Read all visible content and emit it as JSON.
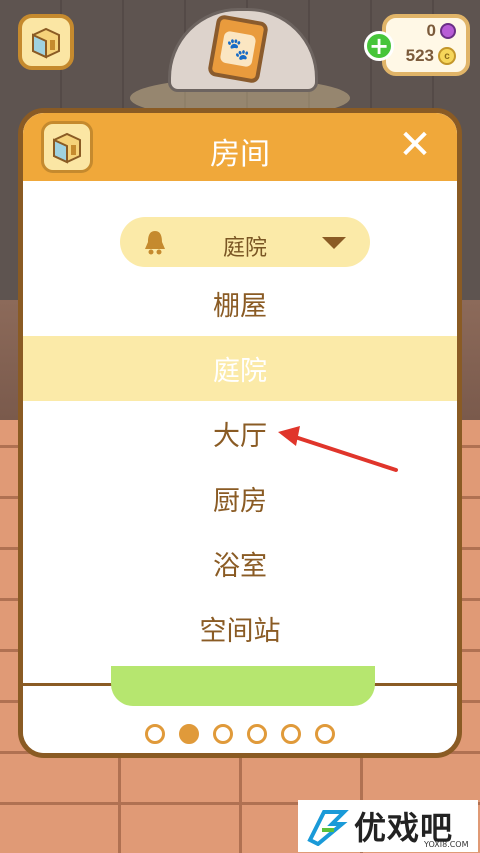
{
  "hud": {
    "room_icon": "room-icon",
    "card_icon": "paw-card-icon",
    "gems": "0",
    "coins": "523",
    "coin_symbol": "c",
    "plus": "+"
  },
  "modal": {
    "title": "房间",
    "close": "✕",
    "selected_room": "庭院",
    "rooms": [
      "棚屋",
      "庭院",
      "大厅",
      "厨房",
      "浴室",
      "空间站"
    ],
    "selected_index": 1,
    "page_count": 6,
    "active_page": 1
  },
  "colors": {
    "header": "#f0a83a",
    "selected_row": "#fbeaa8",
    "text_brown": "#8a5b24",
    "arrow_red": "#e0352b",
    "green_button": "#b6e66f"
  },
  "watermark": {
    "brand": "优戏吧",
    "domain": "YOXI8.COM"
  }
}
